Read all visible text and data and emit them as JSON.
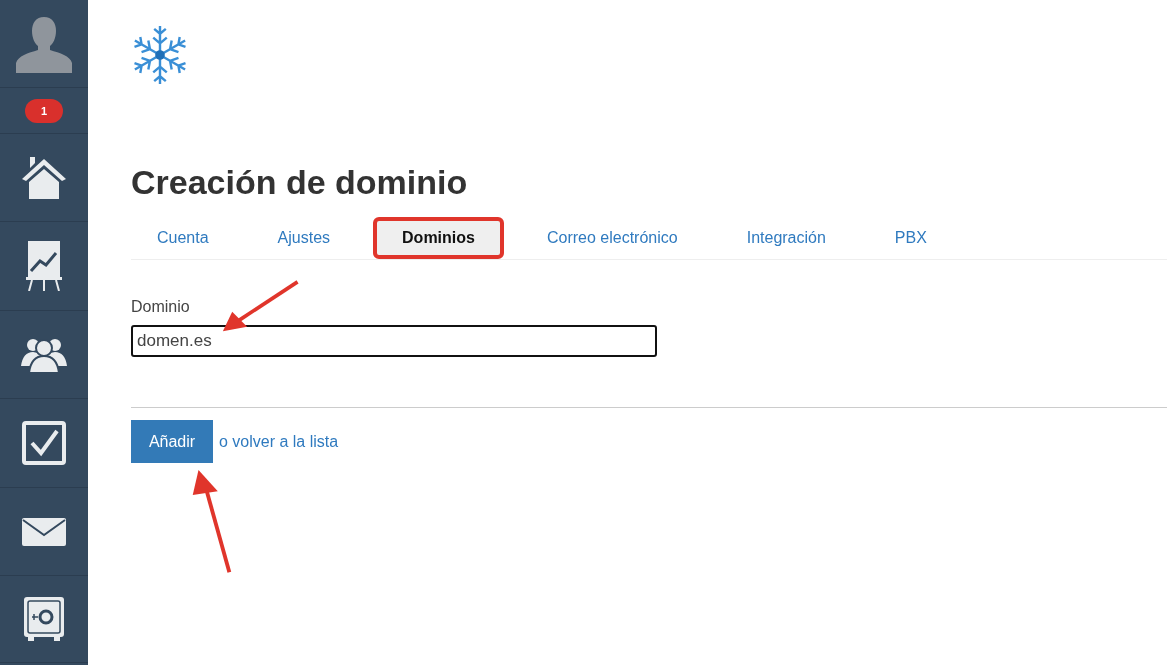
{
  "sidebar": {
    "notification_badge": "1",
    "items": [
      {
        "kind": "home"
      },
      {
        "kind": "chart"
      },
      {
        "kind": "people"
      },
      {
        "kind": "tasks"
      },
      {
        "kind": "mail"
      },
      {
        "kind": "safe"
      }
    ]
  },
  "title": "Creación de dominio",
  "tabs": [
    {
      "label": "Cuenta",
      "selected": false
    },
    {
      "label": "Ajustes",
      "selected": false
    },
    {
      "label": "Dominios",
      "selected": true
    },
    {
      "label": "Correo electrónico",
      "selected": false
    },
    {
      "label": "Integración",
      "selected": false
    },
    {
      "label": "PBX",
      "selected": false
    }
  ],
  "form": {
    "label": "Dominio",
    "value": "domen.es"
  },
  "actions": {
    "button": "Añadir",
    "link": "o volver a la lista"
  }
}
